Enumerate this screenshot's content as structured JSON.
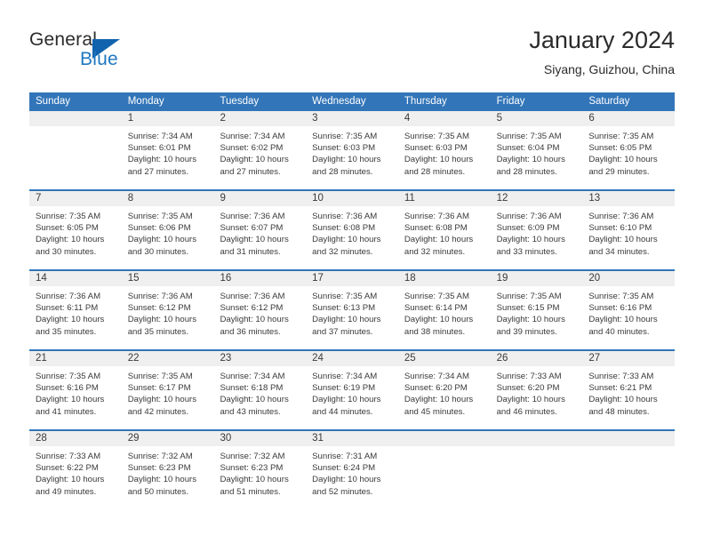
{
  "brand": {
    "word_one": "General",
    "word_two": "Blue",
    "triangle_icon": "blue-triangle-icon",
    "colors": {
      "general": "#2b2b2b",
      "blue": "#1f78c1",
      "triangle": "#1163ad"
    }
  },
  "header": {
    "title": "January 2024",
    "subtitle": "Siyang, Guizhou, China"
  },
  "theme": {
    "header_blue": "#3275b8",
    "day_band_gray": "#efefef",
    "text": "#3a3a3a",
    "page_background": "#ffffff"
  },
  "weekday_headers": [
    "Sunday",
    "Monday",
    "Tuesday",
    "Wednesday",
    "Thursday",
    "Friday",
    "Saturday"
  ],
  "weeks": [
    [
      {
        "day": "",
        "lines": []
      },
      {
        "day": "1",
        "lines": [
          "Sunrise: 7:34 AM",
          "Sunset: 6:01 PM",
          "Daylight: 10 hours",
          "and 27 minutes."
        ]
      },
      {
        "day": "2",
        "lines": [
          "Sunrise: 7:34 AM",
          "Sunset: 6:02 PM",
          "Daylight: 10 hours",
          "and 27 minutes."
        ]
      },
      {
        "day": "3",
        "lines": [
          "Sunrise: 7:35 AM",
          "Sunset: 6:03 PM",
          "Daylight: 10 hours",
          "and 28 minutes."
        ]
      },
      {
        "day": "4",
        "lines": [
          "Sunrise: 7:35 AM",
          "Sunset: 6:03 PM",
          "Daylight: 10 hours",
          "and 28 minutes."
        ]
      },
      {
        "day": "5",
        "lines": [
          "Sunrise: 7:35 AM",
          "Sunset: 6:04 PM",
          "Daylight: 10 hours",
          "and 28 minutes."
        ]
      },
      {
        "day": "6",
        "lines": [
          "Sunrise: 7:35 AM",
          "Sunset: 6:05 PM",
          "Daylight: 10 hours",
          "and 29 minutes."
        ]
      }
    ],
    [
      {
        "day": "7",
        "lines": [
          "Sunrise: 7:35 AM",
          "Sunset: 6:05 PM",
          "Daylight: 10 hours",
          "and 30 minutes."
        ]
      },
      {
        "day": "8",
        "lines": [
          "Sunrise: 7:35 AM",
          "Sunset: 6:06 PM",
          "Daylight: 10 hours",
          "and 30 minutes."
        ]
      },
      {
        "day": "9",
        "lines": [
          "Sunrise: 7:36 AM",
          "Sunset: 6:07 PM",
          "Daylight: 10 hours",
          "and 31 minutes."
        ]
      },
      {
        "day": "10",
        "lines": [
          "Sunrise: 7:36 AM",
          "Sunset: 6:08 PM",
          "Daylight: 10 hours",
          "and 32 minutes."
        ]
      },
      {
        "day": "11",
        "lines": [
          "Sunrise: 7:36 AM",
          "Sunset: 6:08 PM",
          "Daylight: 10 hours",
          "and 32 minutes."
        ]
      },
      {
        "day": "12",
        "lines": [
          "Sunrise: 7:36 AM",
          "Sunset: 6:09 PM",
          "Daylight: 10 hours",
          "and 33 minutes."
        ]
      },
      {
        "day": "13",
        "lines": [
          "Sunrise: 7:36 AM",
          "Sunset: 6:10 PM",
          "Daylight: 10 hours",
          "and 34 minutes."
        ]
      }
    ],
    [
      {
        "day": "14",
        "lines": [
          "Sunrise: 7:36 AM",
          "Sunset: 6:11 PM",
          "Daylight: 10 hours",
          "and 35 minutes."
        ]
      },
      {
        "day": "15",
        "lines": [
          "Sunrise: 7:36 AM",
          "Sunset: 6:12 PM",
          "Daylight: 10 hours",
          "and 35 minutes."
        ]
      },
      {
        "day": "16",
        "lines": [
          "Sunrise: 7:36 AM",
          "Sunset: 6:12 PM",
          "Daylight: 10 hours",
          "and 36 minutes."
        ]
      },
      {
        "day": "17",
        "lines": [
          "Sunrise: 7:35 AM",
          "Sunset: 6:13 PM",
          "Daylight: 10 hours",
          "and 37 minutes."
        ]
      },
      {
        "day": "18",
        "lines": [
          "Sunrise: 7:35 AM",
          "Sunset: 6:14 PM",
          "Daylight: 10 hours",
          "and 38 minutes."
        ]
      },
      {
        "day": "19",
        "lines": [
          "Sunrise: 7:35 AM",
          "Sunset: 6:15 PM",
          "Daylight: 10 hours",
          "and 39 minutes."
        ]
      },
      {
        "day": "20",
        "lines": [
          "Sunrise: 7:35 AM",
          "Sunset: 6:16 PM",
          "Daylight: 10 hours",
          "and 40 minutes."
        ]
      }
    ],
    [
      {
        "day": "21",
        "lines": [
          "Sunrise: 7:35 AM",
          "Sunset: 6:16 PM",
          "Daylight: 10 hours",
          "and 41 minutes."
        ]
      },
      {
        "day": "22",
        "lines": [
          "Sunrise: 7:35 AM",
          "Sunset: 6:17 PM",
          "Daylight: 10 hours",
          "and 42 minutes."
        ]
      },
      {
        "day": "23",
        "lines": [
          "Sunrise: 7:34 AM",
          "Sunset: 6:18 PM",
          "Daylight: 10 hours",
          "and 43 minutes."
        ]
      },
      {
        "day": "24",
        "lines": [
          "Sunrise: 7:34 AM",
          "Sunset: 6:19 PM",
          "Daylight: 10 hours",
          "and 44 minutes."
        ]
      },
      {
        "day": "25",
        "lines": [
          "Sunrise: 7:34 AM",
          "Sunset: 6:20 PM",
          "Daylight: 10 hours",
          "and 45 minutes."
        ]
      },
      {
        "day": "26",
        "lines": [
          "Sunrise: 7:33 AM",
          "Sunset: 6:20 PM",
          "Daylight: 10 hours",
          "and 46 minutes."
        ]
      },
      {
        "day": "27",
        "lines": [
          "Sunrise: 7:33 AM",
          "Sunset: 6:21 PM",
          "Daylight: 10 hours",
          "and 48 minutes."
        ]
      }
    ],
    [
      {
        "day": "28",
        "lines": [
          "Sunrise: 7:33 AM",
          "Sunset: 6:22 PM",
          "Daylight: 10 hours",
          "and 49 minutes."
        ]
      },
      {
        "day": "29",
        "lines": [
          "Sunrise: 7:32 AM",
          "Sunset: 6:23 PM",
          "Daylight: 10 hours",
          "and 50 minutes."
        ]
      },
      {
        "day": "30",
        "lines": [
          "Sunrise: 7:32 AM",
          "Sunset: 6:23 PM",
          "Daylight: 10 hours",
          "and 51 minutes."
        ]
      },
      {
        "day": "31",
        "lines": [
          "Sunrise: 7:31 AM",
          "Sunset: 6:24 PM",
          "Daylight: 10 hours",
          "and 52 minutes."
        ]
      },
      {
        "day": "",
        "lines": []
      },
      {
        "day": "",
        "lines": []
      },
      {
        "day": "",
        "lines": []
      }
    ]
  ]
}
